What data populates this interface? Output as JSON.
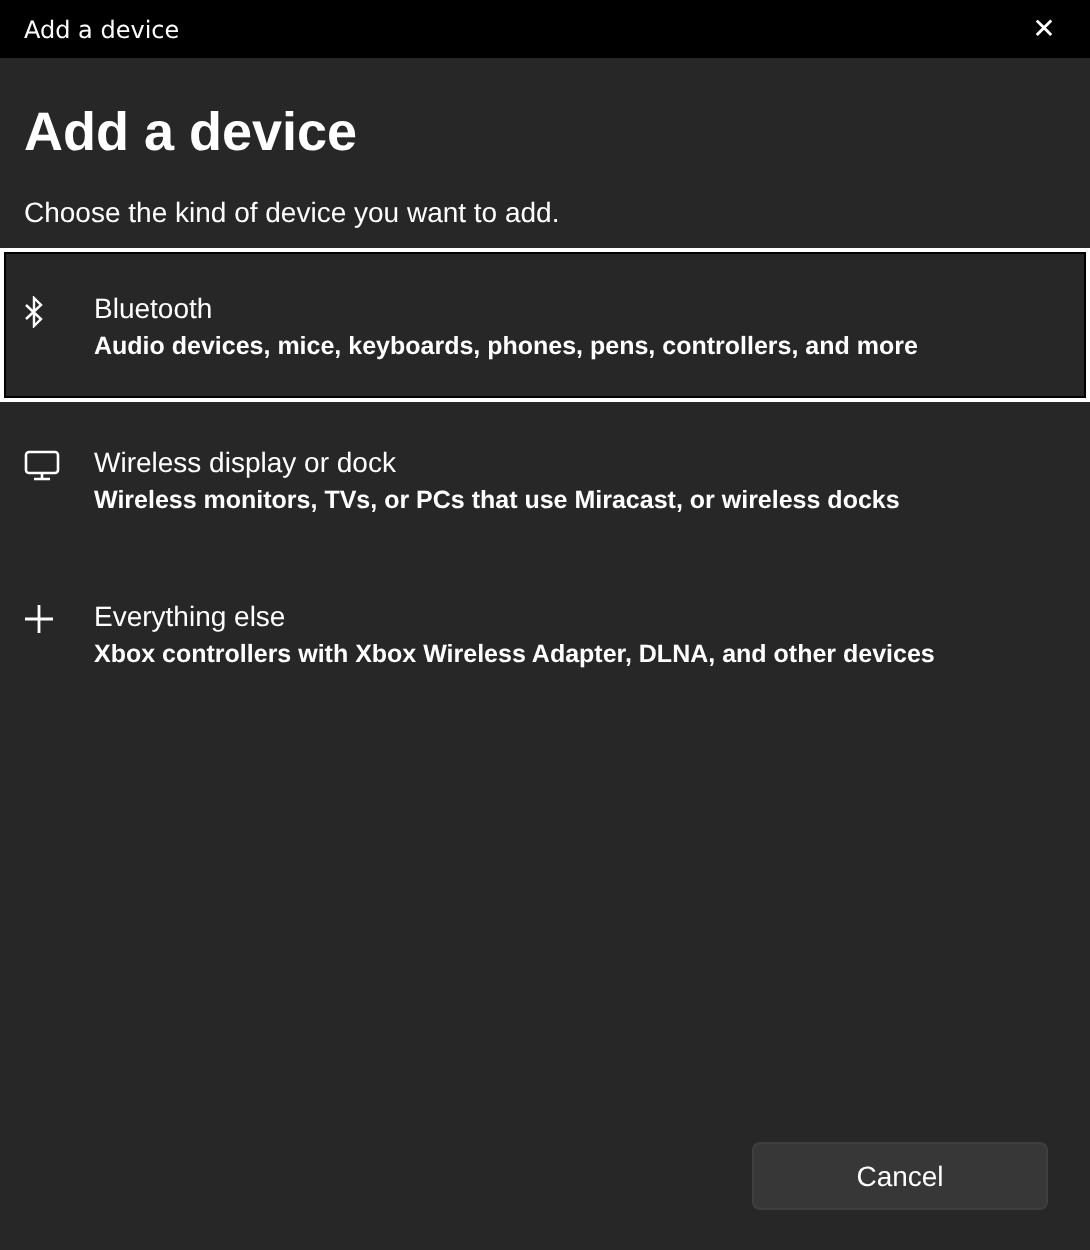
{
  "window": {
    "title": "Add a device",
    "close": "✕"
  },
  "heading": "Add a device",
  "subtitle": "Choose the kind of device you want to add.",
  "options": [
    {
      "kind": "bluetooth",
      "title": "Bluetooth",
      "description": "Audio devices, mice, keyboards, phones, pens, controllers, and more",
      "selected": true
    },
    {
      "kind": "display",
      "title": "Wireless display or dock",
      "description": "Wireless monitors, TVs, or PCs that use Miracast, or wireless docks",
      "selected": false
    },
    {
      "kind": "plus",
      "title": "Everything else",
      "description": "Xbox controllers with Xbox Wireless Adapter, DLNA, and other devices",
      "selected": false
    }
  ],
  "buttons": [
    "Cancel"
  ]
}
